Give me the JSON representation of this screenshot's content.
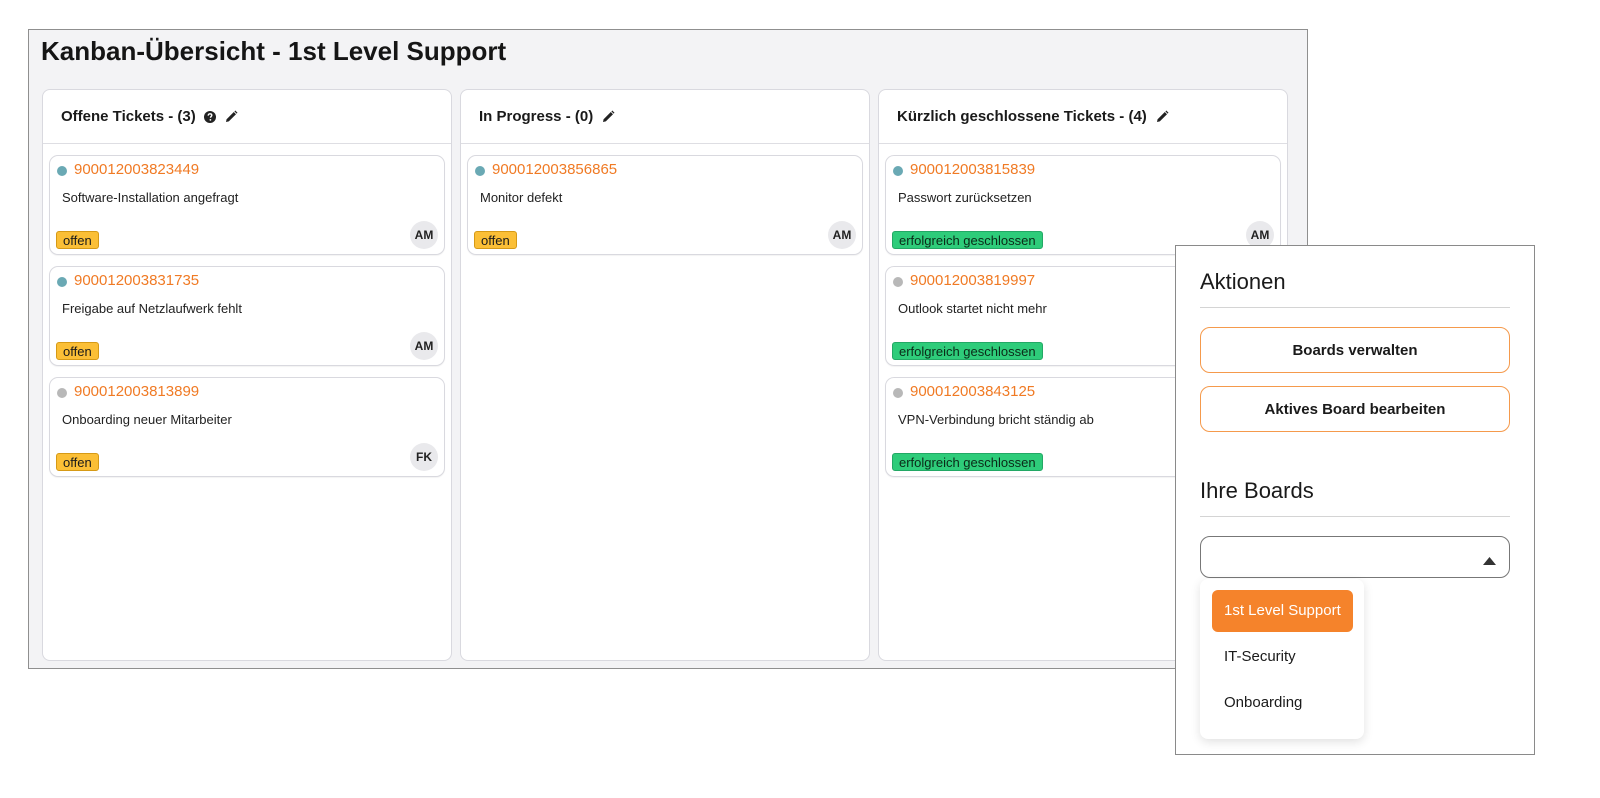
{
  "board": {
    "title": "Kanban-Übersicht - 1st Level Support",
    "columns": [
      {
        "header": "Offene Tickets - (3)",
        "icons": [
          "question-circle-icon",
          "pencil-icon"
        ],
        "cards": [
          {
            "number": "900012003823449",
            "description": "Software-Installation angefragt",
            "status": "offen",
            "status_type": "offen",
            "assignee": "AM",
            "dot_color": "#6aa9b4"
          },
          {
            "number": "900012003831735",
            "description": "Freigabe auf Netzlaufwerk fehlt",
            "status": "offen",
            "status_type": "offen",
            "assignee": "AM",
            "dot_color": "#6aa9b4"
          },
          {
            "number": "900012003813899",
            "description": "Onboarding neuer Mitarbeiter",
            "status": "offen",
            "status_type": "offen",
            "assignee": "FK",
            "dot_color": "#b8b8b8"
          }
        ]
      },
      {
        "header": "In Progress - (0)",
        "icons": [
          "pencil-icon"
        ],
        "cards": [
          {
            "number": "900012003856865",
            "description": "Monitor defekt",
            "status": "offen",
            "status_type": "offen",
            "assignee": "AM",
            "dot_color": "#6aa9b4"
          }
        ]
      },
      {
        "header": "Kürzlich geschlossene Tickets - (4)",
        "icons": [
          "pencil-icon"
        ],
        "cards": [
          {
            "number": "900012003815839",
            "description": "Passwort zurücksetzen",
            "status": "erfolgreich geschlossen",
            "status_type": "closed",
            "assignee": "AM",
            "dot_color": "#6aa9b4"
          },
          {
            "number": "900012003819997",
            "description": "Outlook startet nicht mehr",
            "status": "erfolgreich geschlossen",
            "status_type": "closed",
            "assignee": "",
            "dot_color": "#b8b8b8"
          },
          {
            "number": "900012003843125",
            "description": "VPN-Verbindung bricht ständig ab",
            "status": "erfolgreich geschlossen",
            "status_type": "closed",
            "assignee": "",
            "dot_color": "#b8b8b8"
          }
        ]
      }
    ]
  },
  "panel": {
    "actions_heading": "Aktionen",
    "manage_boards_label": "Boards verwalten",
    "edit_board_label": "Aktives Board bearbeiten",
    "boards_heading": "Ihre Boards",
    "select_value": "",
    "options": [
      {
        "label": "1st Level Support",
        "selected": true
      },
      {
        "label": "IT-Security",
        "selected": false
      },
      {
        "label": "Onboarding",
        "selected": false
      }
    ]
  },
  "colors": {
    "accent": "#f5832b",
    "ticket_number": "#f07a24",
    "badge_open": "#fbbf36",
    "badge_closed": "#2ecc7a"
  }
}
